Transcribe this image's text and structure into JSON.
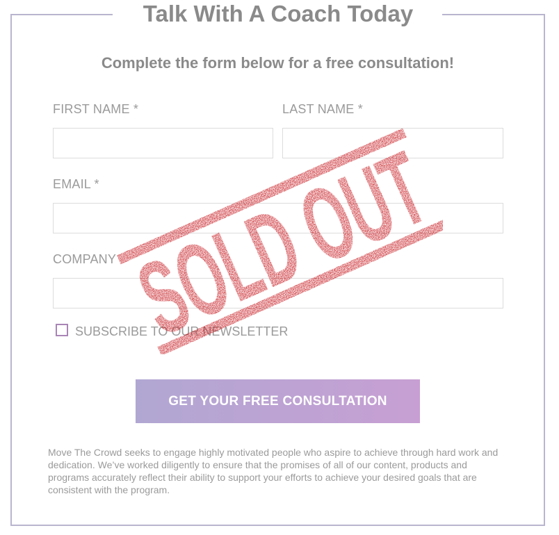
{
  "header": {
    "title": "Talk With A Coach Today",
    "subtitle": "Complete the form below for a free consultation!"
  },
  "form": {
    "first_name_label": "FIRST NAME *",
    "last_name_label": "LAST NAME *",
    "email_label": "EMAIL *",
    "company_label": "COMPANY",
    "first_name_value": "",
    "last_name_value": "",
    "email_value": "",
    "company_value": "",
    "newsletter_label": "SUBSCRIBE TO OUR NEWSLETTER",
    "newsletter_checked": false,
    "submit_label": "GET YOUR FREE CONSULTATION"
  },
  "stamp": {
    "text": "SOLD OUT",
    "color": "#c40f15"
  },
  "footer": {
    "disclaimer": "Move The Crowd seeks to engage highly motivated people who aspire to achieve through hard work and dedication. We’ve worked diligently to ensure that the promises of all of our content, products and programs accurately reflect their ability to support your efforts to achieve your desired goals that are consistent with the program."
  },
  "colors": {
    "frame": "#b9b5cf",
    "button_gradient_start": "#b1a7d3",
    "button_gradient_end": "#c79fd3",
    "text_gray": "#8a8a8a"
  }
}
